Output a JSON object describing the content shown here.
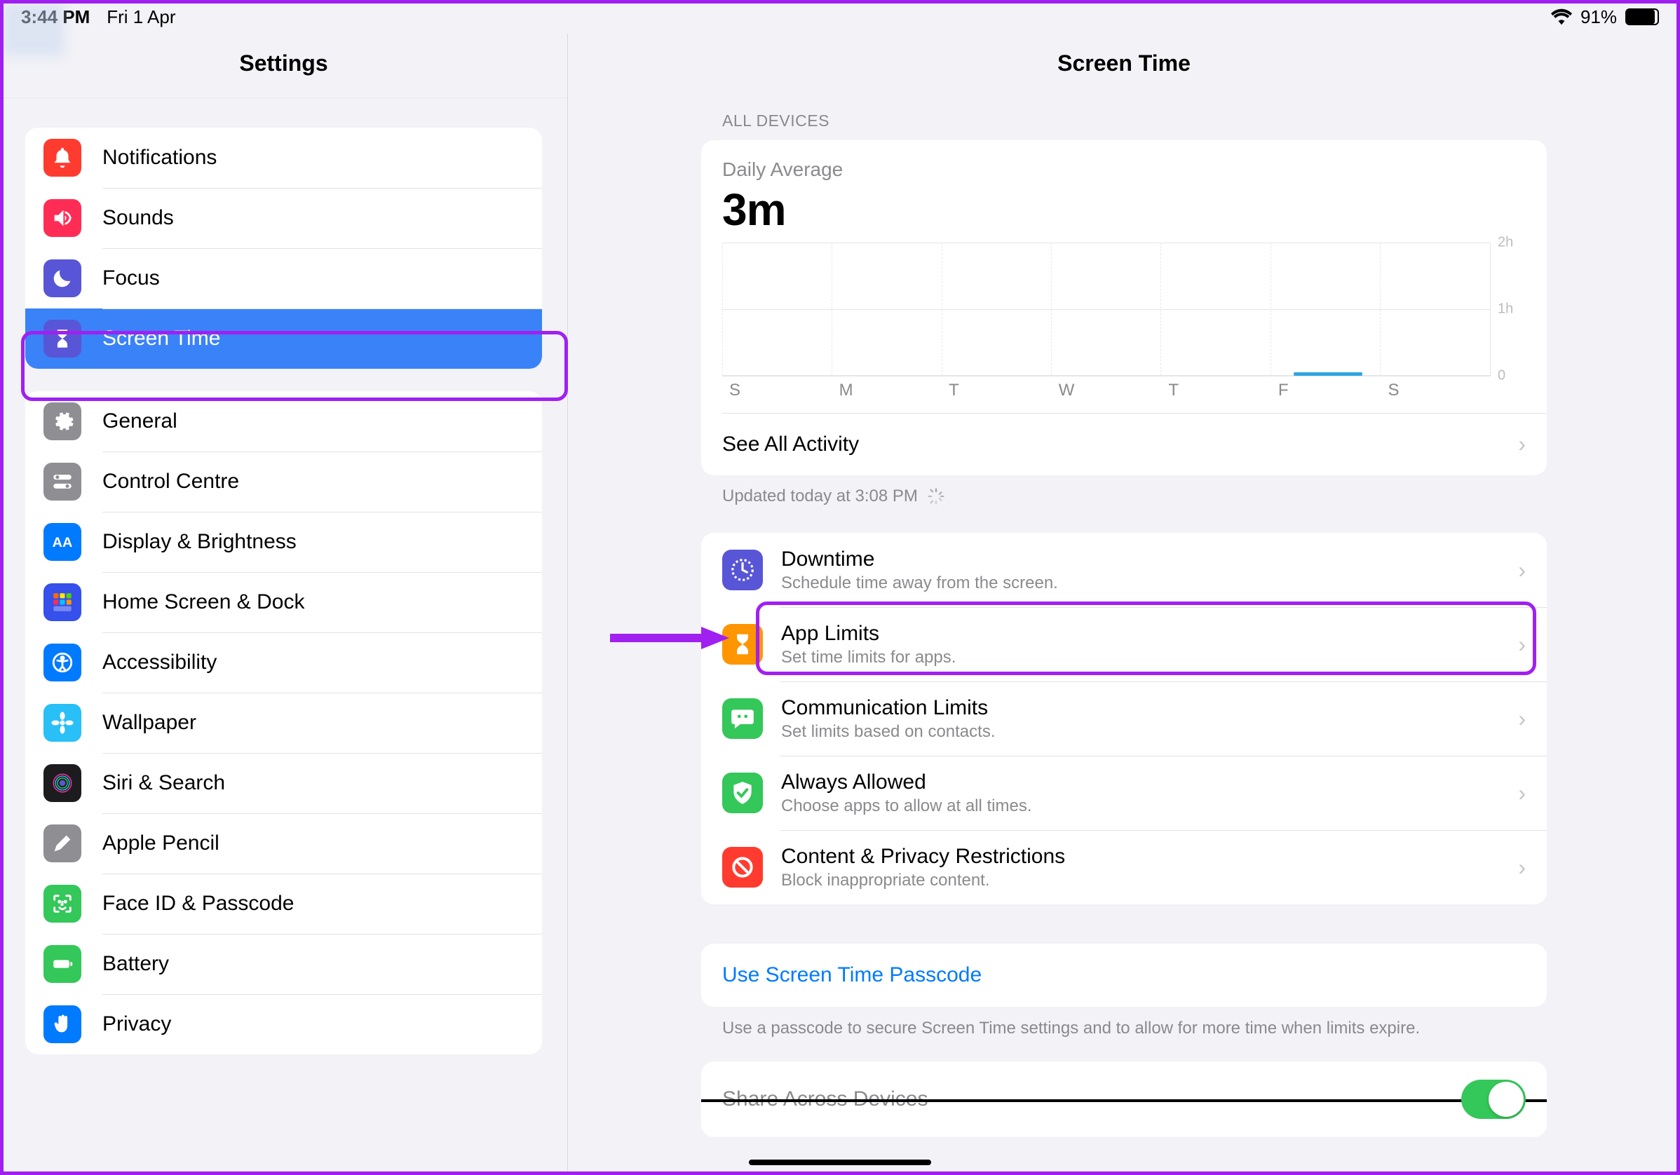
{
  "status": {
    "time": "3:44 PM",
    "date": "Fri 1 Apr",
    "battery_pct": "91%"
  },
  "sidebar": {
    "title": "Settings",
    "group1": [
      {
        "label": "Notifications",
        "icon": "bell",
        "color": "#ff3b30"
      },
      {
        "label": "Sounds",
        "icon": "speaker",
        "color": "#ff2d55"
      },
      {
        "label": "Focus",
        "icon": "moon",
        "color": "#5856d6"
      },
      {
        "label": "Screen Time",
        "icon": "hourglass",
        "color": "#5856d6",
        "selected": true
      }
    ],
    "group2": [
      {
        "label": "General",
        "icon": "gear",
        "color": "#8e8e93"
      },
      {
        "label": "Control Centre",
        "icon": "switches",
        "color": "#8e8e93"
      },
      {
        "label": "Display & Brightness",
        "icon": "aa",
        "color": "#007aff"
      },
      {
        "label": "Home Screen & Dock",
        "icon": "grid",
        "color": "#3550eb"
      },
      {
        "label": "Accessibility",
        "icon": "person",
        "color": "#007aff"
      },
      {
        "label": "Wallpaper",
        "icon": "flower",
        "color": "#29bff7"
      },
      {
        "label": "Siri & Search",
        "icon": "siri",
        "color": "#1c1c1e"
      },
      {
        "label": "Apple Pencil",
        "icon": "pencil",
        "color": "#8e8e93"
      },
      {
        "label": "Face ID & Passcode",
        "icon": "faceid",
        "color": "#34c759"
      },
      {
        "label": "Battery",
        "icon": "battery",
        "color": "#34c759"
      },
      {
        "label": "Privacy",
        "icon": "hand",
        "color": "#007aff"
      }
    ]
  },
  "main": {
    "title": "Screen Time",
    "section_header": "ALL DEVICES",
    "daily_avg_label": "Daily Average",
    "daily_avg_value": "3m",
    "see_all": "See All Activity",
    "updated": "Updated today at 3:08 PM",
    "features": [
      {
        "title": "Downtime",
        "sub": "Schedule time away from the screen.",
        "icon": "downtime",
        "color": "#5856d6"
      },
      {
        "title": "App Limits",
        "sub": "Set time limits for apps.",
        "icon": "hourglass",
        "color": "#ff9500"
      },
      {
        "title": "Communication Limits",
        "sub": "Set limits based on contacts.",
        "icon": "bubble",
        "color": "#34c759"
      },
      {
        "title": "Always Allowed",
        "sub": "Choose apps to allow at all times.",
        "icon": "check",
        "color": "#34c759"
      },
      {
        "title": "Content & Privacy Restrictions",
        "sub": "Block inappropriate content.",
        "icon": "nosign",
        "color": "#ff3b30"
      }
    ],
    "passcode_link": "Use Screen Time Passcode",
    "passcode_caption": "Use a passcode to secure Screen Time settings and to allow for more time when limits expire.",
    "share_label": "Share Across Devices"
  },
  "chart_data": {
    "type": "bar",
    "categories": [
      "S",
      "M",
      "T",
      "W",
      "T",
      "F",
      "S"
    ],
    "values_minutes": [
      0,
      0,
      0,
      0,
      0,
      3,
      0
    ],
    "daily_average_minutes": 3,
    "y_ticks_hours": [
      0,
      1,
      2
    ],
    "y_tick_labels": [
      "0",
      "1h",
      "2h"
    ],
    "ymax_hours": 2,
    "xlabel": "",
    "ylabel": "",
    "notes": "Friday bar tiny (~3 min of 2h scale); all other days zero."
  }
}
